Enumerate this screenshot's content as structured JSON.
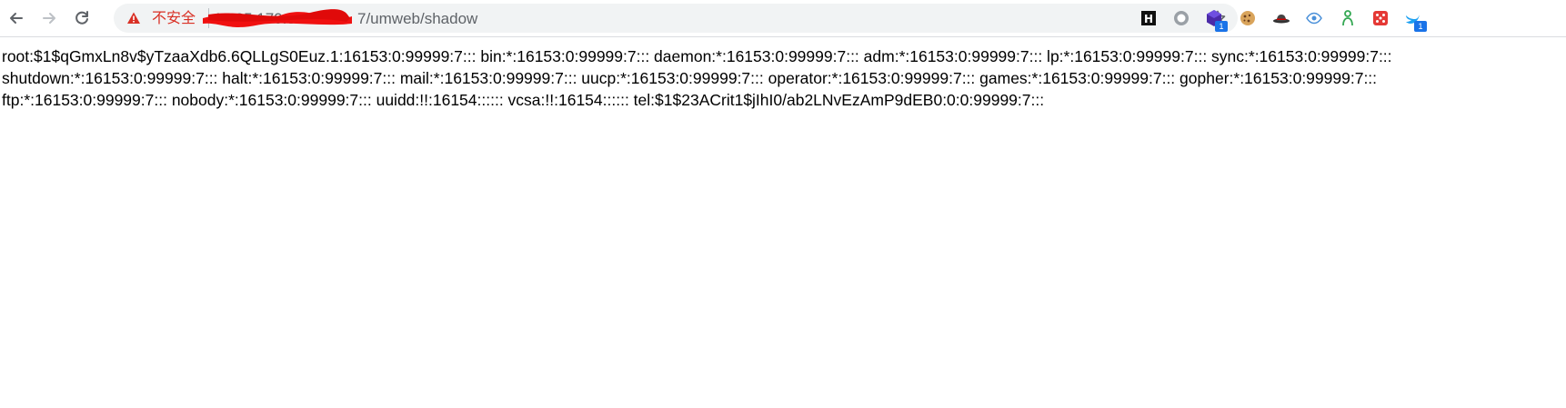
{
  "browser": {
    "nav": {
      "back_icon": "arrow-left-icon",
      "forward_icon": "arrow-right-icon",
      "reload_icon": "reload-icon"
    },
    "omnibox": {
      "security_label": "不安全",
      "url_host": "10.85.170.33:8087",
      "url_path": "7/umweb/shadow",
      "warning_color": "#d93025"
    },
    "bookmark_icon": "star-icon",
    "extensions": [
      {
        "name": "h-square-icon",
        "badge": ""
      },
      {
        "name": "circle-icon",
        "badge": ""
      },
      {
        "name": "purple-cube-icon",
        "badge": "1"
      },
      {
        "name": "cookie-icon",
        "badge": ""
      },
      {
        "name": "hat-icon",
        "badge": ""
      },
      {
        "name": "eye-icon",
        "badge": ""
      },
      {
        "name": "green-figure-icon",
        "badge": ""
      },
      {
        "name": "red-dice-icon",
        "badge": ""
      },
      {
        "name": "blue-bird-icon",
        "badge": "1"
      }
    ]
  },
  "page": {
    "lines": [
      "root:$1$qGmxLn8v$yTzaaXdb6.6QLLgS0Euz.1:16153:0:99999:7::: bin:*:16153:0:99999:7::: daemon:*:16153:0:99999:7::: adm:*:16153:0:99999:7::: lp:*:16153:0:99999:7::: sync:*:16153:0:99999:7:::",
      "shutdown:*:16153:0:99999:7::: halt:*:16153:0:99999:7::: mail:*:16153:0:99999:7::: uucp:*:16153:0:99999:7::: operator:*:16153:0:99999:7::: games:*:16153:0:99999:7::: gopher:*:16153:0:99999:7:::",
      "ftp:*:16153:0:99999:7::: nobody:*:16153:0:99999:7::: uuidd:!!:16154:::::: vcsa:!!:16154:::::: tel:$1$23ACrit1$jIhI0/ab2LNvEzAmP9dEB0:0:0:99999:7:::"
    ]
  }
}
